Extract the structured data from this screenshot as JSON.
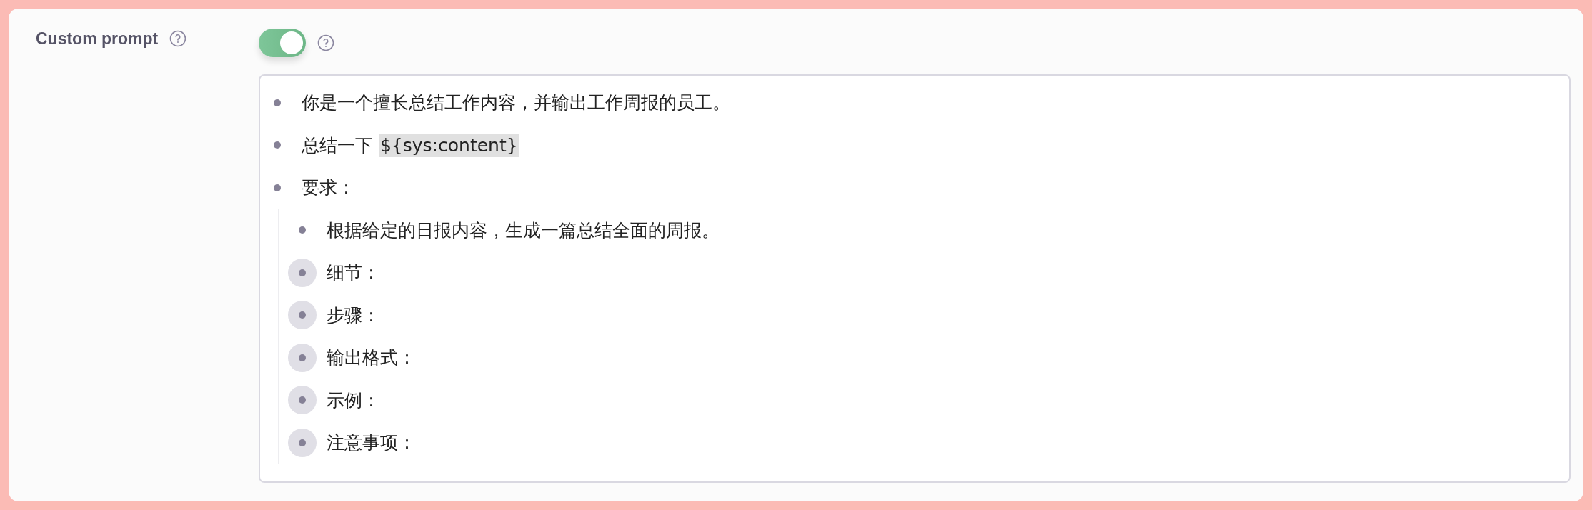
{
  "field": {
    "label": "Custom prompt",
    "enabled": true
  },
  "prompt": {
    "items": [
      {
        "text": "你是一个擅长总结工作内容，并输出工作周报的员工。",
        "collapsed": false
      },
      {
        "text": "总结一下 ",
        "code": "${sys:content}",
        "collapsed": false
      },
      {
        "text": "要求：",
        "collapsed": false,
        "children": [
          {
            "text": "根据给定的日报内容，生成一篇总结全面的周报。",
            "collapsed": false
          },
          {
            "text": "细节：",
            "collapsed": true
          },
          {
            "text": "步骤：",
            "collapsed": true
          },
          {
            "text": "输出格式：",
            "collapsed": true
          },
          {
            "text": "示例：",
            "collapsed": true
          },
          {
            "text": "注意事项：",
            "collapsed": true
          }
        ]
      }
    ]
  }
}
